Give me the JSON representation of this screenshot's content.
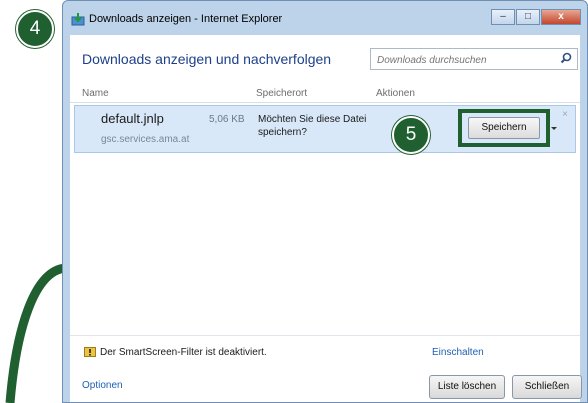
{
  "window": {
    "title": "Downloads anzeigen - Internet Explorer",
    "buttons": {
      "minimize": "–",
      "maximize": "□",
      "close": "x"
    }
  },
  "header": {
    "title": "Downloads anzeigen und nachverfolgen",
    "search_placeholder": "Downloads durchsuchen"
  },
  "columns": {
    "name": "Name",
    "location": "Speicherort",
    "actions": "Aktionen"
  },
  "download": {
    "filename": "default.jnlp",
    "size": "5,06 KB",
    "source": "gsc.services.ama.at",
    "message": "Möchten Sie diese Datei speichern?",
    "save_label": "Speichern",
    "dismiss": "×"
  },
  "footer": {
    "smartscreen": "Der SmartScreen-Filter ist deaktiviert.",
    "enable": "Einschalten",
    "options": "Optionen",
    "clear_list": "Liste löschen",
    "close": "Schließen"
  },
  "annotations": {
    "step4": "4",
    "step5": "5",
    "color": "#1f5f30"
  }
}
